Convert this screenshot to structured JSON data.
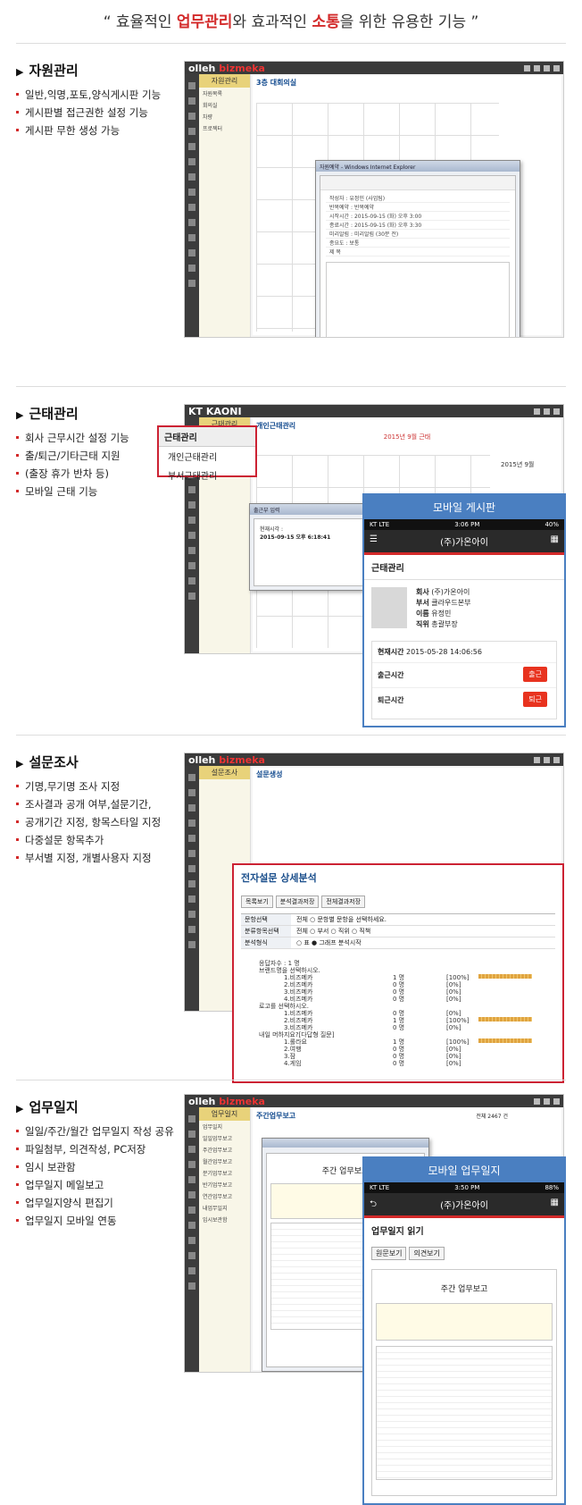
{
  "headline": {
    "prefix": "“ 효율적인 ",
    "hl1": "업무관리",
    "mid": "와 효과적인 ",
    "hl2": "소통",
    "suffix": "을 위한 유용한 기능 ”"
  },
  "sections": [
    {
      "title": "자원관리",
      "bullets": [
        "일반,익명,포토,양식게시판 기능",
        "게시판별 접근권한 설정 기능",
        "게시판 무한 생성 가능"
      ]
    },
    {
      "title": "근태관리",
      "bullets": [
        "회사 근무시간 설정 기능",
        "출/퇴근/기타근태 지원",
        "(출장 휴가 반차 등)",
        "모바일 근태 기능"
      ]
    },
    {
      "title": "설문조사",
      "bullets": [
        "기명,무기명 조사 지정",
        "조사결과 공개 여부,설문기간,",
        "공개기간 지정, 항목스타일 지정",
        "다중설문 항목추가",
        "부서별 지정, 개별사용자 지정"
      ]
    },
    {
      "title": "업무일지",
      "bullets": [
        "일일/주간/월간 업무일지 작성 공유",
        "파일첨부, 의견작성, PC저장",
        "임시 보관함",
        "업무일지 메일보고",
        "업무일지양식 편집기",
        "업무일지 모바일 연동"
      ]
    }
  ],
  "shot1": {
    "logo_a": "olleh ",
    "logo_b": "bizmeka",
    "side_label": "자원관리",
    "page_title": "3층 대회의실",
    "popup_title": "자원예약 - Windows Internet Explorer",
    "popup_fields": [
      "작성자",
      "반복예약",
      "시작시간",
      "종료시간",
      "미리알림",
      "종요도",
      "제 목"
    ],
    "popup_values": [
      "유정민 (사업팀)",
      "반복예약",
      "2015-09-15 (화)  오후 3:00",
      "2015-09-15 (화)  오후 3:30",
      "미리알림 (30분 전)",
      "보통",
      ""
    ]
  },
  "shot2": {
    "logo": "KT KAONI",
    "side_label": "근태관리",
    "page_title": "개인근태관리",
    "callout_header": "근태관리",
    "callout_items": [
      "개인근태관리",
      "부서근태관리"
    ],
    "cal_title": "2015년 9월 근태",
    "popup_title": "출근부 입력",
    "popup_line1": "현재시각 :",
    "popup_line2": "2015-09-15 오후 6:18:41",
    "mini_cal": "2015년 9월"
  },
  "mobile1": {
    "header": "모바일 게시판",
    "carrier": "KT  LTE",
    "time": "3:06 PM",
    "battery": "40%",
    "app": "(주)가온아이",
    "section": "근태관리",
    "info": [
      [
        "회사",
        "(주)가온아이"
      ],
      [
        "부서",
        "클라우드본부"
      ],
      [
        "이름",
        "유정민"
      ],
      [
        "직위",
        "총괄부장"
      ]
    ],
    "now_label": "현재시간",
    "now_value": "2015-05-28 14:06:56",
    "in_label": "출근시간",
    "in_btn": "출근",
    "out_label": "퇴근시간",
    "out_btn": "퇴근"
  },
  "shot3": {
    "logo_a": "olleh ",
    "logo_b": "bizmeka",
    "side_label": "설문조사",
    "page_title": "설문생성",
    "survey_title": "전자설문 상세분석",
    "buttons": [
      "목록보기",
      "분석결과저장",
      "전체결과저장"
    ],
    "rows": [
      [
        "문항선택",
        "전체  ○ 문항별  문항을 선택하세요."
      ],
      [
        "분류항목선택",
        "전체  ○ 부서  ○ 직위  ○ 직책"
      ],
      [
        "분석형식",
        "○ 표  ● 그래프  분석시작"
      ]
    ],
    "results": [
      [
        "응답자수 : 1 명",
        ""
      ],
      [
        "브랜드명을 선택하시오.",
        ""
      ],
      [
        "1.비즈메카",
        "1 명",
        "[100%]"
      ],
      [
        "2.비즈메카",
        "0 명",
        "[0%]"
      ],
      [
        "3.비즈메카",
        "0 명",
        "[0%]"
      ],
      [
        "4.비즈메카",
        "0 명",
        "[0%]"
      ],
      [
        "로고를 선택하시오.",
        ""
      ],
      [
        "1.비즈메카",
        "0 명",
        "[0%]"
      ],
      [
        "2.비즈메카",
        "1 명",
        "[100%]"
      ],
      [
        "3.비즈메카",
        "0 명",
        "[0%]"
      ],
      [
        "내일 머하지요?[다답형 질문]",
        ""
      ],
      [
        "1.롤라요",
        "1 명",
        "[100%]"
      ],
      [
        "2.여행",
        "0 명",
        "[0%]"
      ],
      [
        "3.잠",
        "0 명",
        "[0%]"
      ],
      [
        "4.게임",
        "0 명",
        "[0%]"
      ]
    ]
  },
  "shot4": {
    "logo_a": "olleh ",
    "logo_b": "bizmeka",
    "side_label": "업무일지",
    "page_title": "주간업무보고",
    "total": "전체 2467 건",
    "doc_title": "주간 업무보고",
    "side_items": [
      "업무일지",
      "일일업무보고",
      "주간업무보고",
      "월간업무보고",
      "분기업무보고",
      "반기업무보고",
      "연간업무보고",
      "내업무일지",
      "임시보관함"
    ]
  },
  "mobile2": {
    "header": "모바일 업무일지",
    "carrier": "KT  LTE",
    "time": "3:50 PM",
    "battery": "88%",
    "app": "(주)가온아이",
    "section": "업무일지 읽기",
    "btn1": "원문보기",
    "btn2": "의견보기",
    "doc_title": "주간 업무보고"
  }
}
